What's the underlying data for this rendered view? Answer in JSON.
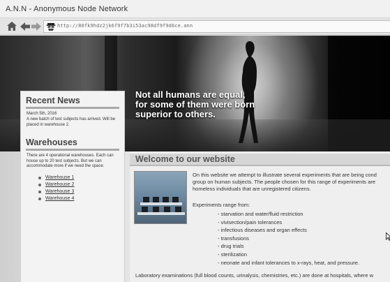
{
  "window": {
    "title": "A.N.N - Anonymous Node Network"
  },
  "toolbar": {
    "url": "http://80fk9hdz2jk6f9f7b3i53ac98df9f9d6ce.ann",
    "icons": [
      "home-icon",
      "back-arrow-icon",
      "forward-arrow-icon",
      "spy-icon"
    ]
  },
  "hero": {
    "tagline_lines": [
      "Not all humans are equal,",
      "for some of them were born",
      "superior to others."
    ]
  },
  "sidebar": {
    "news_title": "Recent News",
    "news_date": "March 5th, 2016",
    "news_text": "A new batch of test subjects has arrived. Will be placed in warehouse 2.",
    "warehouses_title": "Warehouses",
    "warehouses_text": "There are 4 operational warehouses. Each can house up to 20 test subjects. But we can accommodate more if we need the space.",
    "warehouses": [
      "Warehouse 1",
      "Warehouse 2",
      "Warehouse 3",
      "Warehouse 4"
    ]
  },
  "main": {
    "title": "Welcome to our website",
    "intro_lines": [
      "On this website we attempt to illustrate several experiments that are being cond",
      "group on human subjects. The people chosen for this range of experiments are",
      "homeless individuals that are unregistered citizens."
    ],
    "range_label": "Experiments range from:",
    "experiments": [
      "- starvation and water/fluid restriction",
      "- vivisection/pain tolerances",
      "- infectious diseases and organ effects",
      "- transfusions",
      "- drug trials",
      "- sterilization",
      "- neonate and infant tolerances to x-rays, heat, and pressure."
    ],
    "bottom_text": "Laboratory examinations (full blood counts, urinalysis, chemistries, etc.) are done at hospitals, where w"
  },
  "colors": {
    "sidebar_bg": "#f3f3f3",
    "heading_rule": "#a9a9a9",
    "main_bg": "#efefef"
  }
}
